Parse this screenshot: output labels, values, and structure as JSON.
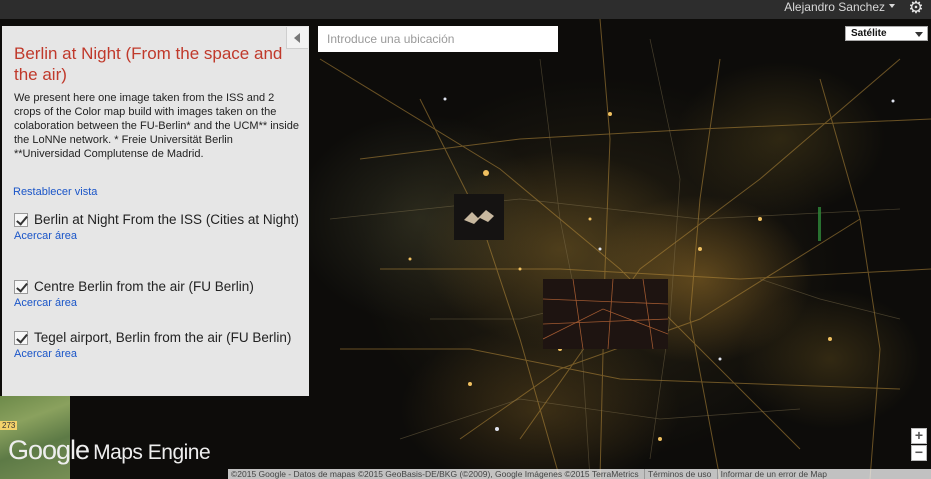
{
  "header": {
    "user_name": "Alejandro Sanchez",
    "settings_icon": "gear-icon"
  },
  "search": {
    "placeholder": "Introduce una ubicación"
  },
  "map_type": {
    "selected": "Satélite"
  },
  "panel": {
    "title": "Berlin at Night (From the space and the air)",
    "description": "We present here one image taken from the ISS and 2 crops of the Color map build with images taken on the colaboration between the FU-Berlin* and the UCM** inside the LoNNe network. * Freie Universität Berlin **Universidad Complutense de Madrid.",
    "reset_view": "Restablecer vista",
    "layers": [
      {
        "name": "Berlin at Night From the ISS (Cities at Night)",
        "zoom": "Acercar área",
        "checked": true
      },
      {
        "name": "Centre Berlin from the air (FU Berlin)",
        "zoom": "Acercar área",
        "checked": true
      },
      {
        "name": "Tegel airport, Berlin from the air (FU Berlin)",
        "zoom": "Acercar área",
        "checked": true
      }
    ]
  },
  "branding": {
    "google": "Google",
    "product": "Maps Engine"
  },
  "map_labels": {
    "road": "273"
  },
  "zoom": {
    "in": "+",
    "out": "−"
  },
  "attribution": {
    "data": "©2015 Google - Datos de mapas ©2015 GeoBasis-DE/BKG (©2009), Google Imágenes ©2015 TerraMetrics",
    "terms": "Términos de uso",
    "report": "Informar de un error de Map"
  }
}
